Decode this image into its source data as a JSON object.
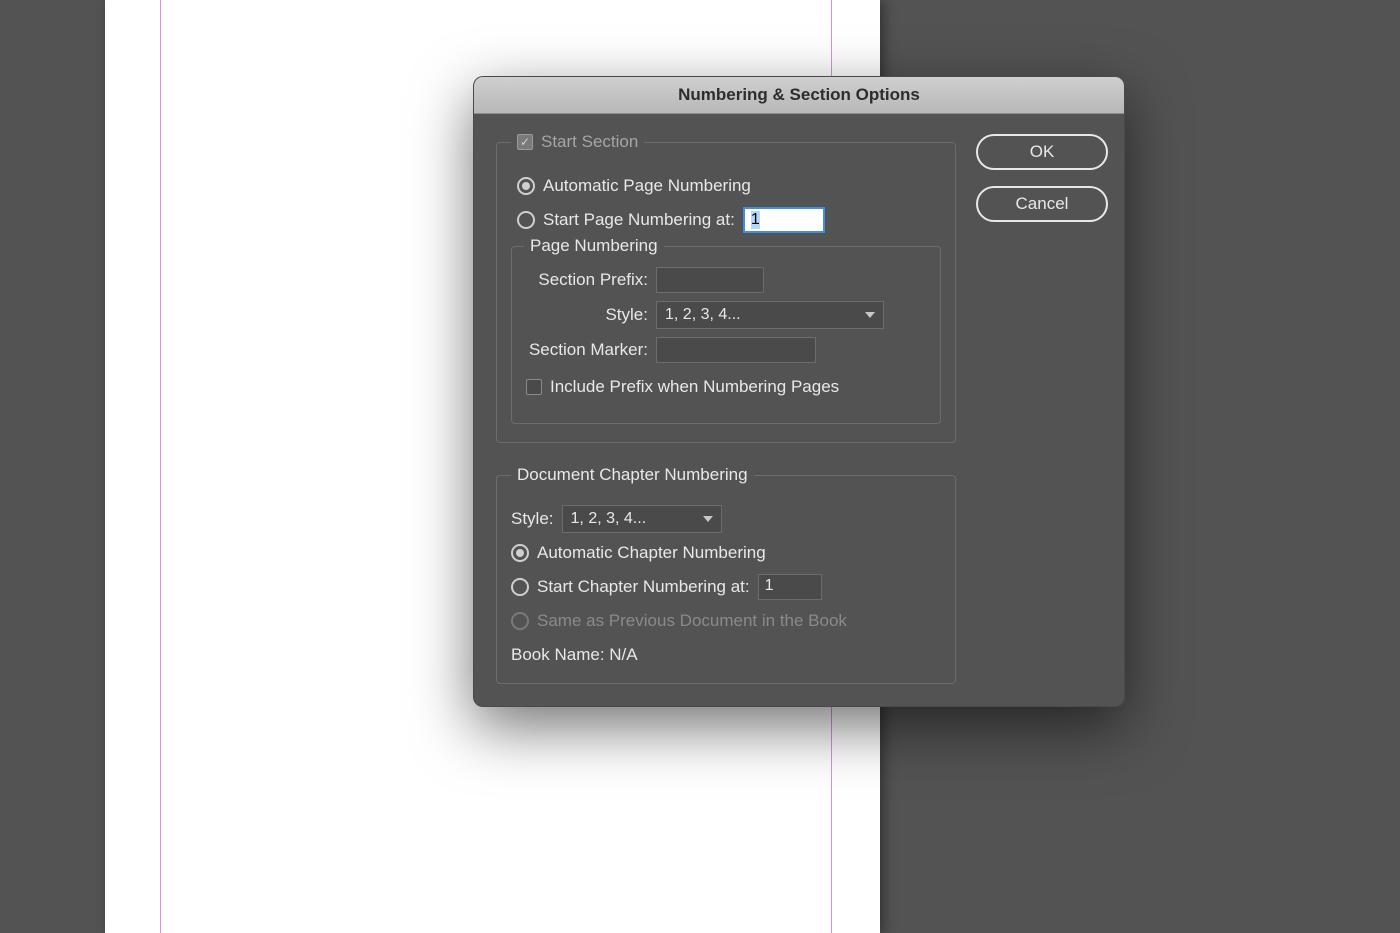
{
  "dialog": {
    "title": "Numbering & Section Options",
    "buttons": {
      "ok": "OK",
      "cancel": "Cancel"
    },
    "section": {
      "start_section_label": "Start Section",
      "start_section_checked": true,
      "radio_auto_label": "Automatic Page Numbering",
      "radio_start_at_label": "Start Page Numbering at:",
      "start_at_value": "1",
      "page_numbering": {
        "legend": "Page Numbering",
        "section_prefix_label": "Section Prefix:",
        "section_prefix_value": "",
        "style_label": "Style:",
        "style_value": "1, 2, 3, 4...",
        "section_marker_label": "Section Marker:",
        "section_marker_value": "",
        "include_prefix_label": "Include Prefix when Numbering Pages"
      }
    },
    "chapter": {
      "legend": "Document Chapter Numbering",
      "style_label": "Style:",
      "style_value": "1, 2, 3, 4...",
      "radio_auto_label": "Automatic Chapter Numbering",
      "radio_start_at_label": "Start Chapter Numbering at:",
      "start_at_value": "1",
      "radio_same_prev_label": "Same as Previous Document in the Book",
      "book_name_label": "Book Name: N/A"
    }
  }
}
